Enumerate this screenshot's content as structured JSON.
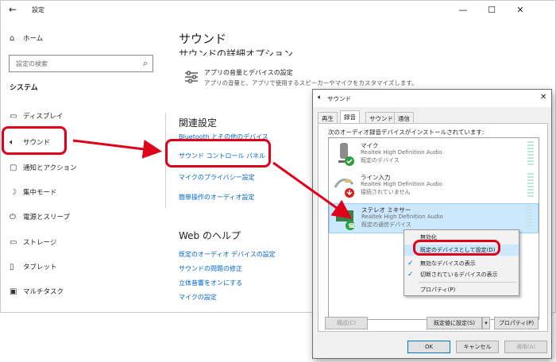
{
  "settings": {
    "title": "設定",
    "home": "ホーム",
    "search_placeholder": "設定の検索",
    "section": "システム",
    "nav": [
      "ディスプレイ",
      "サウンド",
      "通知とアクション",
      "集中モード",
      "電源とスリープ",
      "ストレージ",
      "タブレット",
      "マルチタスク"
    ],
    "page_title": "サウンド",
    "advanced_heading": "サウンドの詳細オプション",
    "app_volume_title": "アプリの音量とデバイスの設定",
    "app_volume_desc": "アプリの音量と、アプリで使用するスピーカーやマイクをカスタマイズします。",
    "related_heading": "関連設定",
    "related_links": [
      "Bluetooth とその他のデバイス",
      "サウンド コントロール パネル",
      "マイクのプライバシー設定",
      "簡単操作のオーディオ設定"
    ],
    "web_help_heading": "Web のヘルプ",
    "help_links": [
      "既定のオーディオ デバイスの設定",
      "サウンドの問題の修正",
      "立体音響をオンにする",
      "マイクの設定"
    ]
  },
  "sound_dialog": {
    "title": "サウンド",
    "tabs": [
      "再生",
      "録音",
      "サウンド",
      "通信"
    ],
    "active_tab": "録音",
    "instructions": "次のオーディオ録音デバイスがインストールされています:",
    "devices": [
      {
        "name": "マイク",
        "driver": "Realtek High Definition Audio",
        "status": "既定のデバイス"
      },
      {
        "name": "ライン入力",
        "driver": "Realtek High Definition Audio",
        "status": "接続されていません"
      },
      {
        "name": "ステレオ ミキサー",
        "driver": "Realtek High Definition Audio",
        "status": "既定の通信デバイス"
      }
    ],
    "configure": "構成(C)",
    "set_default": "既定値に設定(S)",
    "properties": "プロパティ(P)",
    "ok": "OK",
    "cancel": "キャンセル",
    "apply": "適用(A)"
  },
  "context_menu": {
    "items": [
      "無効化",
      "既定のデバイスとして設定(D)",
      "無効なデバイスの表示",
      "切断されているデバイスの表示",
      "プロパティ(P)"
    ]
  },
  "colors": {
    "accent": "#0078d7",
    "link": "#0066cc",
    "highlight": "#e1001a",
    "ok_green": "#2e9e3e",
    "err_red": "#d21f1f"
  }
}
